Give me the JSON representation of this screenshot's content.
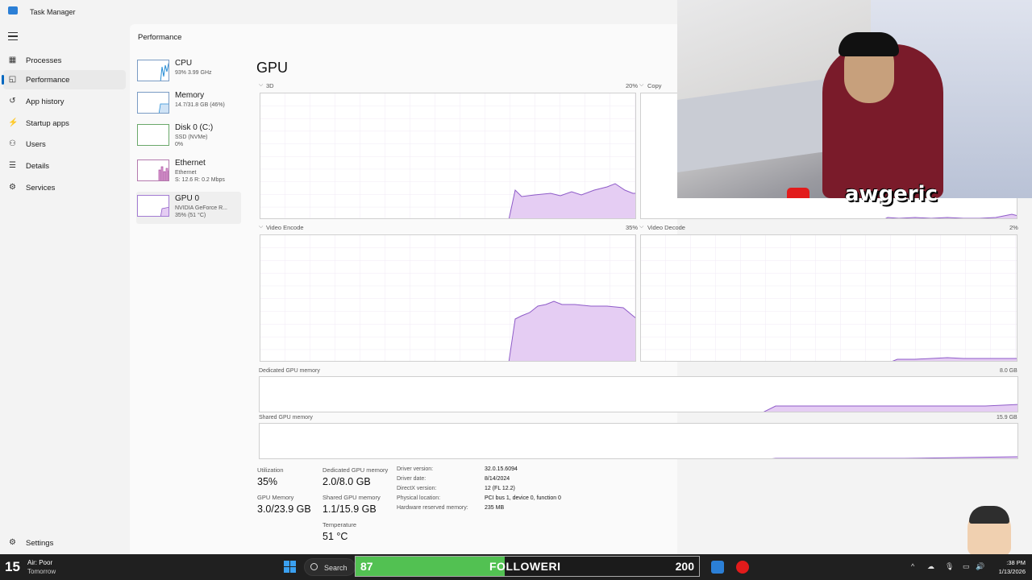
{
  "app": {
    "title": "Task Manager"
  },
  "nav": {
    "items": [
      {
        "label": "Processes",
        "icon": "processes-icon",
        "glyph": "▦"
      },
      {
        "label": "Performance",
        "icon": "performance-icon",
        "glyph": "◱"
      },
      {
        "label": "App history",
        "icon": "history-icon",
        "glyph": "↺"
      },
      {
        "label": "Startup apps",
        "icon": "startup-icon",
        "glyph": "⚡"
      },
      {
        "label": "Users",
        "icon": "users-icon",
        "glyph": "⚇"
      },
      {
        "label": "Details",
        "icon": "details-icon",
        "glyph": "☰"
      },
      {
        "label": "Services",
        "icon": "services-icon",
        "glyph": "⚙"
      }
    ],
    "settings": "Settings"
  },
  "page": {
    "header": "Performance"
  },
  "devices": [
    {
      "name": "CPU",
      "line1": "93% 3.99 GHz",
      "line2": "",
      "color": "#2b8fd6"
    },
    {
      "name": "Memory",
      "line1": "14.7/31.8 GB (46%)",
      "line2": "",
      "color": "#2b8fd6"
    },
    {
      "name": "Disk 0 (C:)",
      "line1": "SSD (NVMe)",
      "line2": "0%",
      "color": "#4caf50"
    },
    {
      "name": "Ethernet",
      "line1": "Ethernet",
      "line2": "S: 12.6 R: 0.2 Mbps",
      "color": "#a7469c"
    },
    {
      "name": "GPU 0",
      "line1": "NVIDIA GeForce R...",
      "line2": "35% (51 °C)",
      "color": "#8e5bc8"
    }
  ],
  "gpu": {
    "title": "GPU",
    "engines": [
      {
        "name": "3D",
        "value": "20%"
      },
      {
        "name": "Copy",
        "value": ""
      },
      {
        "name": "Video Encode",
        "value": "35%"
      },
      {
        "name": "Video Decode",
        "value": "2%"
      }
    ],
    "dedicated": {
      "label": "Dedicated GPU memory",
      "max": "8.0 GB"
    },
    "shared": {
      "label": "Shared GPU memory",
      "max": "15.9 GB"
    },
    "stats": {
      "utilization_label": "Utilization",
      "utilization": "35%",
      "dedicated_label": "Dedicated GPU memory",
      "dedicated": "2.0/8.0 GB",
      "gpu_memory_label": "GPU Memory",
      "gpu_memory": "3.0/23.9 GB",
      "shared_label": "Shared GPU memory",
      "shared": "1.1/15.9 GB",
      "temperature_label": "Temperature",
      "temperature": "51 °C"
    },
    "info": [
      {
        "k": "Driver version:",
        "v": "32.0.15.6094"
      },
      {
        "k": "Driver date:",
        "v": "8/14/2024"
      },
      {
        "k": "DirectX version:",
        "v": "12 (FL 12.2)"
      },
      {
        "k": "Physical location:",
        "v": "PCI bus 1, device 0, function 0"
      },
      {
        "k": "Hardware reserved memory:",
        "v": "235 MB"
      }
    ]
  },
  "overlay": {
    "handle": "awgeric"
  },
  "taskbar": {
    "weather_num": "15",
    "weather_line1": "Air: Poor",
    "weather_line2": "Tomorrow",
    "search": "Search",
    "follow": {
      "current": "87",
      "label": "FOLLOWERI",
      "goal": "200",
      "progress": 0.435
    },
    "time": ":38 PM",
    "date": "1/13/2026"
  },
  "colors": {
    "accent": "#0067c0",
    "gpu": "#8e5bc8",
    "gpu_fill": "#e5cdf3",
    "goal_bar": "#52c152"
  }
}
